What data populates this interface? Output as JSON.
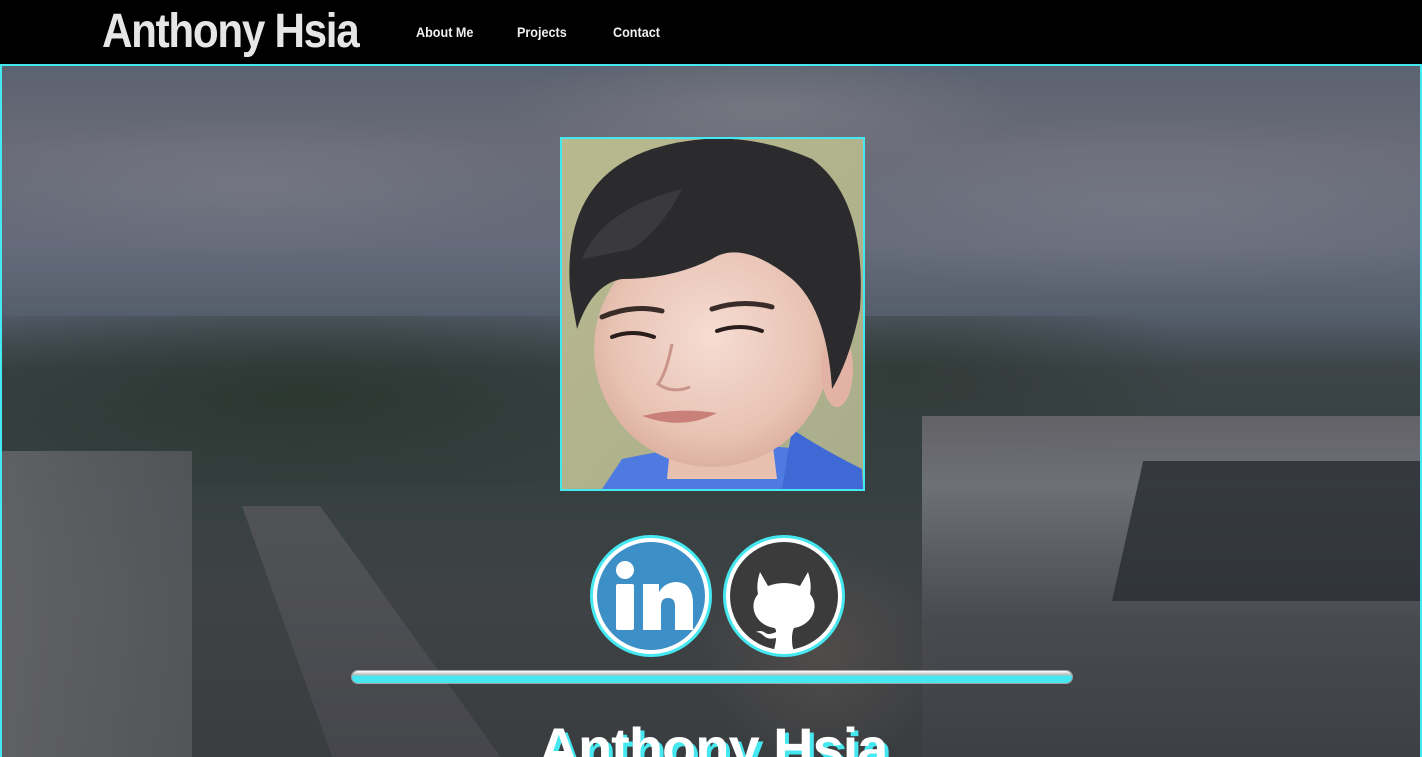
{
  "nav": {
    "brand": "Anthony Hsia",
    "links": [
      {
        "label": "About Me"
      },
      {
        "label": "Projects"
      },
      {
        "label": "Contact"
      }
    ]
  },
  "hero": {
    "name": "Anthony Hsia",
    "profile_photo": "portrait-photo",
    "social": [
      {
        "name": "linkedin-icon",
        "glyph": "in",
        "color": "#3d8fc7"
      },
      {
        "name": "github-icon",
        "color": "#3b3b3b"
      }
    ]
  },
  "colors": {
    "accent": "#45e8f0",
    "nav_bg": "#000000",
    "brand_text": "#e6e6e6"
  }
}
